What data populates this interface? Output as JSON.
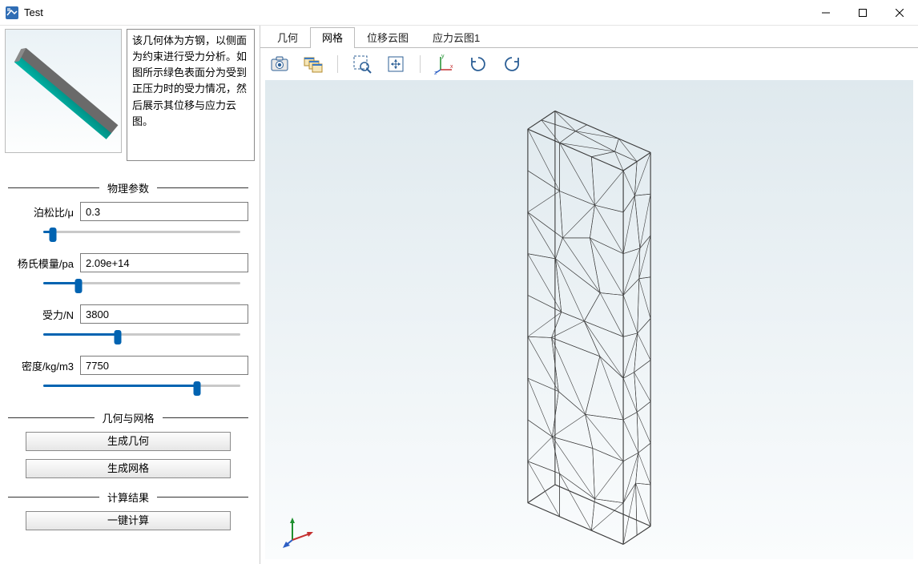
{
  "window": {
    "title": "Test"
  },
  "description": "该几何体为方钢，以侧面为约束进行受力分析。如图所示绿色表面分为受到正压力时的受力情况，然后展示其位移与应力云图。",
  "sections": {
    "physical": "物理参数",
    "geom_mesh": "几何与网格",
    "results": "计算结果"
  },
  "params": {
    "poisson": {
      "label": "泊松比/μ",
      "value": "0.3",
      "pct": 5
    },
    "young": {
      "label": "杨氏模量/pa",
      "value": "2.09e+14",
      "pct": 18
    },
    "force": {
      "label": "受力/N",
      "value": "3800",
      "pct": 38
    },
    "density": {
      "label": "密度/kg/m3",
      "value": "7750",
      "pct": 78
    }
  },
  "buttons": {
    "gen_geom": "生成几何",
    "gen_mesh": "生成网格",
    "compute": "一键计算"
  },
  "tabs": [
    "几何",
    "网格",
    "位移云图",
    "应力云图1"
  ],
  "active_tab": 1,
  "toolbar_icons": [
    "camera-icon",
    "multi-windows-icon",
    "zoom-select-icon",
    "fit-icon",
    "axes-xyz-icon",
    "rotate-cw-icon",
    "rotate-ccw-icon"
  ]
}
